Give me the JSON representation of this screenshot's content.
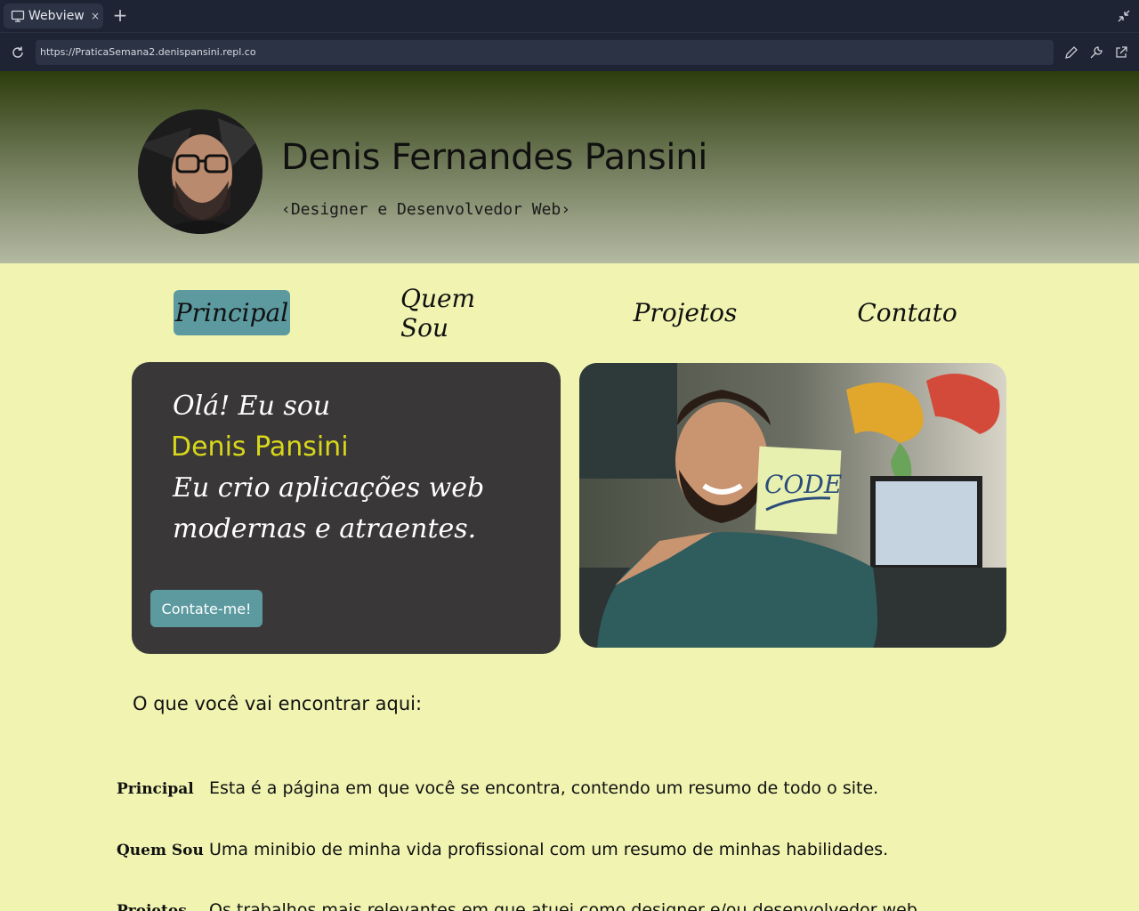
{
  "browser": {
    "tab_label": "Webview",
    "tab_close": "×",
    "new_tab": "+",
    "url": "https://PraticaSemana2.denispansini.repl.co"
  },
  "header": {
    "name": "Denis Fernandes Pansini",
    "role": "‹Designer e Desenvolvedor Web›"
  },
  "nav": {
    "items": [
      {
        "label": "Principal",
        "active": true
      },
      {
        "label": "Quem Sou"
      },
      {
        "label": "Projetos"
      },
      {
        "label": "Contato"
      }
    ]
  },
  "intro": {
    "greeting": "Olá! Eu sou",
    "name": "Denis Pansini",
    "line1": "Eu crio aplicações web",
    "line2": "modernas e atraentes.",
    "button": "Contate-me!",
    "photo_note": "CODE"
  },
  "content": {
    "section_title": "O que você vai encontrar aqui:",
    "definitions": [
      {
        "term": "Principal",
        "desc": "Esta é a página em que você se encontra, contendo um resumo de todo o site."
      },
      {
        "term": "Quem Sou",
        "desc": "Uma minibio de minha vida profissional com um resumo de minhas habilidades."
      },
      {
        "term": "Projetos",
        "desc": "Os trabalhos mais relevantes em que atuei como designer e/ou desenvolvedor web."
      }
    ]
  },
  "colors": {
    "page_bg": "#f0f4b0",
    "accent": "#5c9aa0",
    "card_bg": "#3a3739",
    "highlight": "#d8d81a"
  }
}
